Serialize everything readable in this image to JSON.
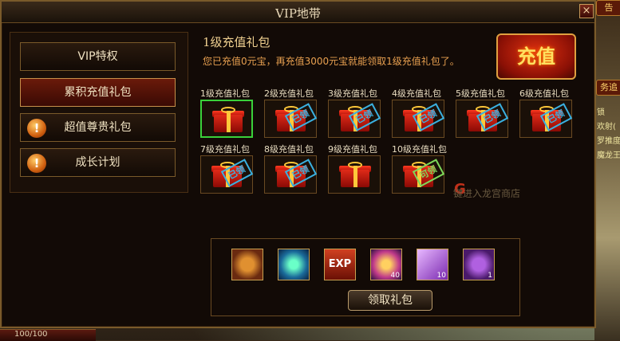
{
  "window": {
    "title": "VIP地带",
    "close_label": "×"
  },
  "nav": [
    {
      "label": "VIP特权",
      "icon": ""
    },
    {
      "label": "累积充值礼包",
      "icon": ""
    },
    {
      "label": "超值尊贵礼包",
      "icon": "!"
    },
    {
      "label": "成长计划",
      "icon": "!"
    }
  ],
  "pack": {
    "title": "1级充值礼包",
    "description": "您已充值0元宝，再充值3000元宝就能领取1级充值礼包了。"
  },
  "recharge_label": "充值",
  "gifts": [
    {
      "label": "1级充值礼包",
      "stamp": ""
    },
    {
      "label": "2级充值礼包",
      "stamp": "已领"
    },
    {
      "label": "3级充值礼包",
      "stamp": "已领"
    },
    {
      "label": "4级充值礼包",
      "stamp": "已领"
    },
    {
      "label": "5级充值礼包",
      "stamp": "已领"
    },
    {
      "label": "6级充值礼包",
      "stamp": "已领"
    },
    {
      "label": "7级充值礼包",
      "stamp": "已领"
    },
    {
      "label": "8级充值礼包",
      "stamp": "已领"
    },
    {
      "label": "9级充值礼包",
      "stamp": ""
    },
    {
      "label": "10级充值礼包",
      "stamp": "可领"
    }
  ],
  "rewards": [
    {
      "icon": "coin-icon",
      "count": ""
    },
    {
      "icon": "jade-icon",
      "count": ""
    },
    {
      "icon": "exp-icon",
      "count": "",
      "text": "EXP"
    },
    {
      "icon": "gem-icon",
      "count": "40"
    },
    {
      "icon": "crystal-icon",
      "count": "10"
    },
    {
      "icon": "bag-icon",
      "count": "1"
    }
  ],
  "claim_label": "领取礼包",
  "background": {
    "shop_hint": "键进入龙宫商店",
    "hp_text": "100/100",
    "side_tabs": [
      "告",
      "务追"
    ],
    "side_texts": [
      "锁",
      "欢射(",
      "罗推度:6",
      "魔龙王("
    ]
  },
  "colors": {
    "accent": "#e8a050",
    "selected": "#3ad13a",
    "stamp_claimed": "#3ab0e0",
    "stamp_claimable": "#7ed85a"
  }
}
